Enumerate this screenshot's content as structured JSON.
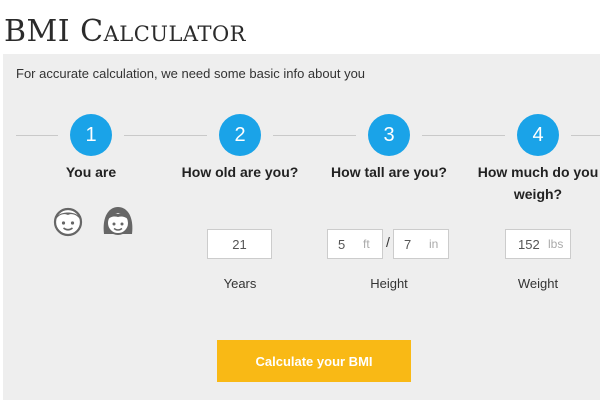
{
  "title": "BMI Calculator",
  "intro": "For accurate calculation, we need some basic info about you",
  "steps": [
    {
      "number": "1",
      "label": "You are"
    },
    {
      "number": "2",
      "label": "How old are you?"
    },
    {
      "number": "3",
      "label": "How tall are you?"
    },
    {
      "number": "4",
      "label": "How much do you weigh?"
    }
  ],
  "gender": {
    "male_icon": "male-face-icon",
    "female_icon": "female-face-icon"
  },
  "age": {
    "value": "21",
    "caption": "Years"
  },
  "height": {
    "feet_value": "5",
    "feet_unit": "ft",
    "separator": "/",
    "inches_value": "7",
    "inches_unit": "in",
    "caption": "Height"
  },
  "weight": {
    "value": "152",
    "unit": "lbs",
    "caption": "Weight"
  },
  "calculate_label": "Calculate your BMI",
  "colors": {
    "accent": "#1aa3e8",
    "button": "#f9b915",
    "panel": "#eeeeee"
  }
}
